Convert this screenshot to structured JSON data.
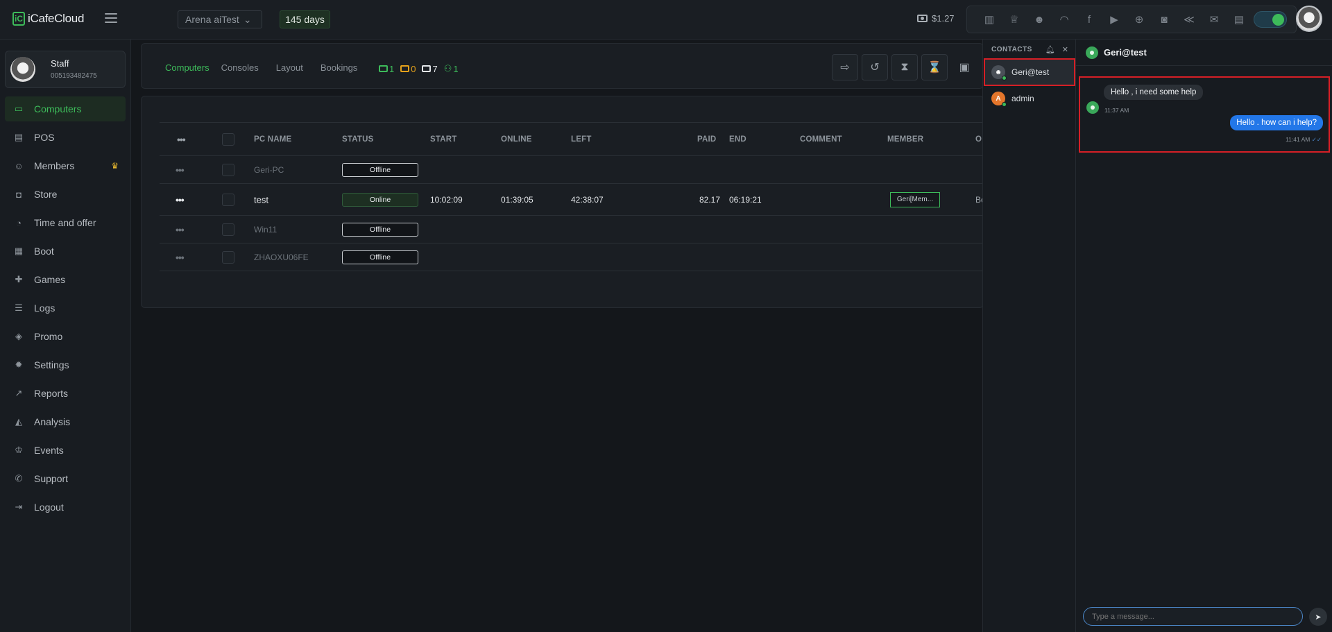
{
  "app": {
    "logo_text": "iCafeCloud",
    "logo_mark": "iC"
  },
  "topbar": {
    "branch": "Arena aiTest",
    "days": "145 days",
    "balance": "$1.27",
    "tools": [
      "bar-chart-icon",
      "trophy-icon",
      "users-icon",
      "rss-icon",
      "facebook-icon",
      "youtube-icon",
      "globe-icon",
      "icafe-icon",
      "handshake-icon",
      "mail-icon",
      "chat-icon"
    ]
  },
  "staff": {
    "name": "Staff",
    "id": "005193482475"
  },
  "nav": [
    {
      "label": "Computers",
      "icon": "monitor-icon",
      "glyph": "▭"
    },
    {
      "label": "POS",
      "icon": "register-icon",
      "glyph": "▤"
    },
    {
      "label": "Members",
      "icon": "members-icon",
      "glyph": "☺",
      "badge": "♛"
    },
    {
      "label": "Store",
      "icon": "bag-icon",
      "glyph": "◘"
    },
    {
      "label": "Time and offer",
      "icon": "stopwatch-icon",
      "glyph": "◔"
    },
    {
      "label": "Boot",
      "icon": "windows-icon",
      "glyph": "▦"
    },
    {
      "label": "Games",
      "icon": "gamepad-icon",
      "glyph": "✚"
    },
    {
      "label": "Logs",
      "icon": "list-icon",
      "glyph": "☰"
    },
    {
      "label": "Promo",
      "icon": "tag-icon",
      "glyph": "◈"
    },
    {
      "label": "Settings",
      "icon": "gear-icon",
      "glyph": "✹"
    },
    {
      "label": "Reports",
      "icon": "line-chart-icon",
      "glyph": "↗"
    },
    {
      "label": "Analysis",
      "icon": "area-chart-icon",
      "glyph": "◭"
    },
    {
      "label": "Events",
      "icon": "crown-icon",
      "glyph": "♔"
    },
    {
      "label": "Support",
      "icon": "phone-icon",
      "glyph": "✆"
    },
    {
      "label": "Logout",
      "icon": "logout-icon",
      "glyph": "⇥"
    }
  ],
  "tabs": [
    "Computers",
    "Consoles",
    "Layout",
    "Bookings"
  ],
  "counts": {
    "green": "1",
    "orange": "0",
    "white": "7",
    "members": "1"
  },
  "actions": [
    {
      "name": "logout-icon",
      "glyph": "⇨"
    },
    {
      "name": "history-icon",
      "glyph": "↺"
    },
    {
      "name": "hourglass-icon",
      "glyph": "⧗"
    },
    {
      "name": "hourglass-outline-icon",
      "glyph": "⌛"
    },
    {
      "name": "lock-icon",
      "glyph": "▣"
    }
  ],
  "table": {
    "headers": {
      "more": "•••",
      "pc_name": "PC NAME",
      "status": "STATUS",
      "start": "START",
      "online": "ONLINE",
      "left": "LEFT",
      "paid": "PAID",
      "end": "END",
      "comment": "COMMENT",
      "member": "MEMBER",
      "overflow": "O"
    },
    "rows": [
      {
        "more": "•••",
        "pc_name": "Geri-PC",
        "status": "Offline",
        "start": "",
        "online": "",
        "left": "",
        "paid": "",
        "end": "",
        "comment": "",
        "member": "",
        "overflow": ""
      },
      {
        "more": "•••",
        "pc_name": "test",
        "status": "Online",
        "start": "10:02:09",
        "online": "01:39:05",
        "left": "42:38:07",
        "paid": "82.17",
        "end": "06:19:21",
        "comment": "",
        "member": "Geri[Mem...",
        "overflow": "Bo"
      },
      {
        "more": "•••",
        "pc_name": "Win11",
        "status": "Offline",
        "start": "",
        "online": "",
        "left": "",
        "paid": "",
        "end": "",
        "comment": "",
        "member": "",
        "overflow": ""
      },
      {
        "more": "•••",
        "pc_name": "ZHAOXU06FE",
        "status": "Offline",
        "start": "",
        "online": "",
        "left": "",
        "paid": "",
        "end": "",
        "comment": "",
        "member": "",
        "overflow": ""
      }
    ]
  },
  "contacts": {
    "title": "CONTACTS",
    "list": [
      {
        "name": "Geri@test",
        "initial": "",
        "color": "#4a5058"
      },
      {
        "name": "admin",
        "initial": "A",
        "color": "#e4762b"
      }
    ]
  },
  "chat": {
    "title": "Geri@test",
    "messages": [
      {
        "text": "Hello , i need some help",
        "time": "11:37 AM",
        "dir": "in"
      },
      {
        "text": "Hello . how can i help?",
        "time": "11:41 AM",
        "dir": "out"
      }
    ],
    "placeholder": "Type a message..."
  },
  "colors": {
    "accent": "#3dbb5a",
    "orange": "#e4a11b",
    "highlight": "#d61f26",
    "bubble_out": "#2377e8"
  }
}
